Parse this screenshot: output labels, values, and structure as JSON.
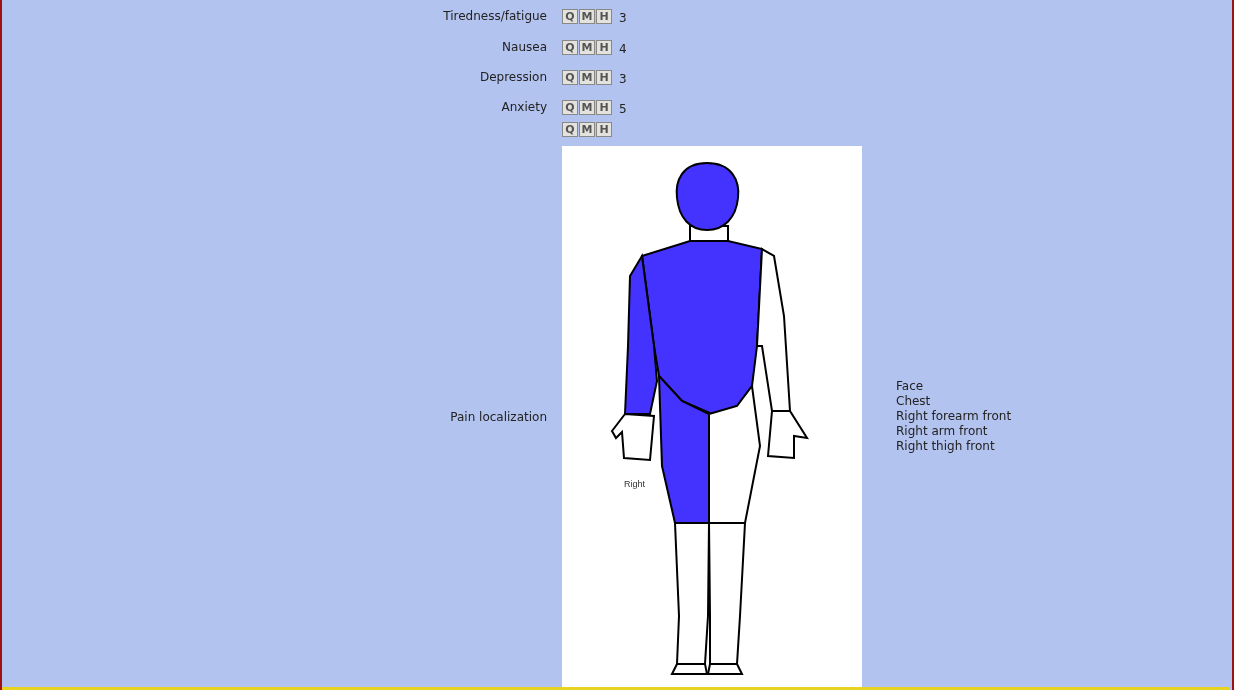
{
  "symptoms": [
    {
      "label": "Tiredness/fatigue",
      "buttons": [
        "Q",
        "M",
        "H"
      ],
      "score": "3"
    },
    {
      "label": "Nausea",
      "buttons": [
        "Q",
        "M",
        "H"
      ],
      "score": "4"
    },
    {
      "label": "Depression",
      "buttons": [
        "Q",
        "M",
        "H"
      ],
      "score": "3"
    },
    {
      "label": "Anxiety",
      "buttons": [
        "Q",
        "M",
        "H"
      ],
      "score": "5"
    },
    {
      "buttons": [
        "Q",
        "M",
        "H"
      ]
    }
  ],
  "pain_localization": {
    "label": "Pain localization",
    "figure_side_label": "Right",
    "regions": [
      {
        "kind": "head",
        "highlighted": true
      },
      {
        "kind": "torso",
        "highlighted": true
      },
      {
        "kind": "right_arm",
        "highlighted": true
      },
      {
        "kind": "left_arm",
        "highlighted": false
      },
      {
        "kind": "right_thigh",
        "highlighted": true
      },
      {
        "kind": "left_thigh",
        "highlighted": false
      },
      {
        "kind": "right_leg",
        "highlighted": false
      },
      {
        "kind": "left_leg",
        "highlighted": false
      }
    ],
    "locations": [
      "Face",
      "Chest",
      "Right forearm front",
      "Right arm front",
      "Right thigh front"
    ]
  }
}
